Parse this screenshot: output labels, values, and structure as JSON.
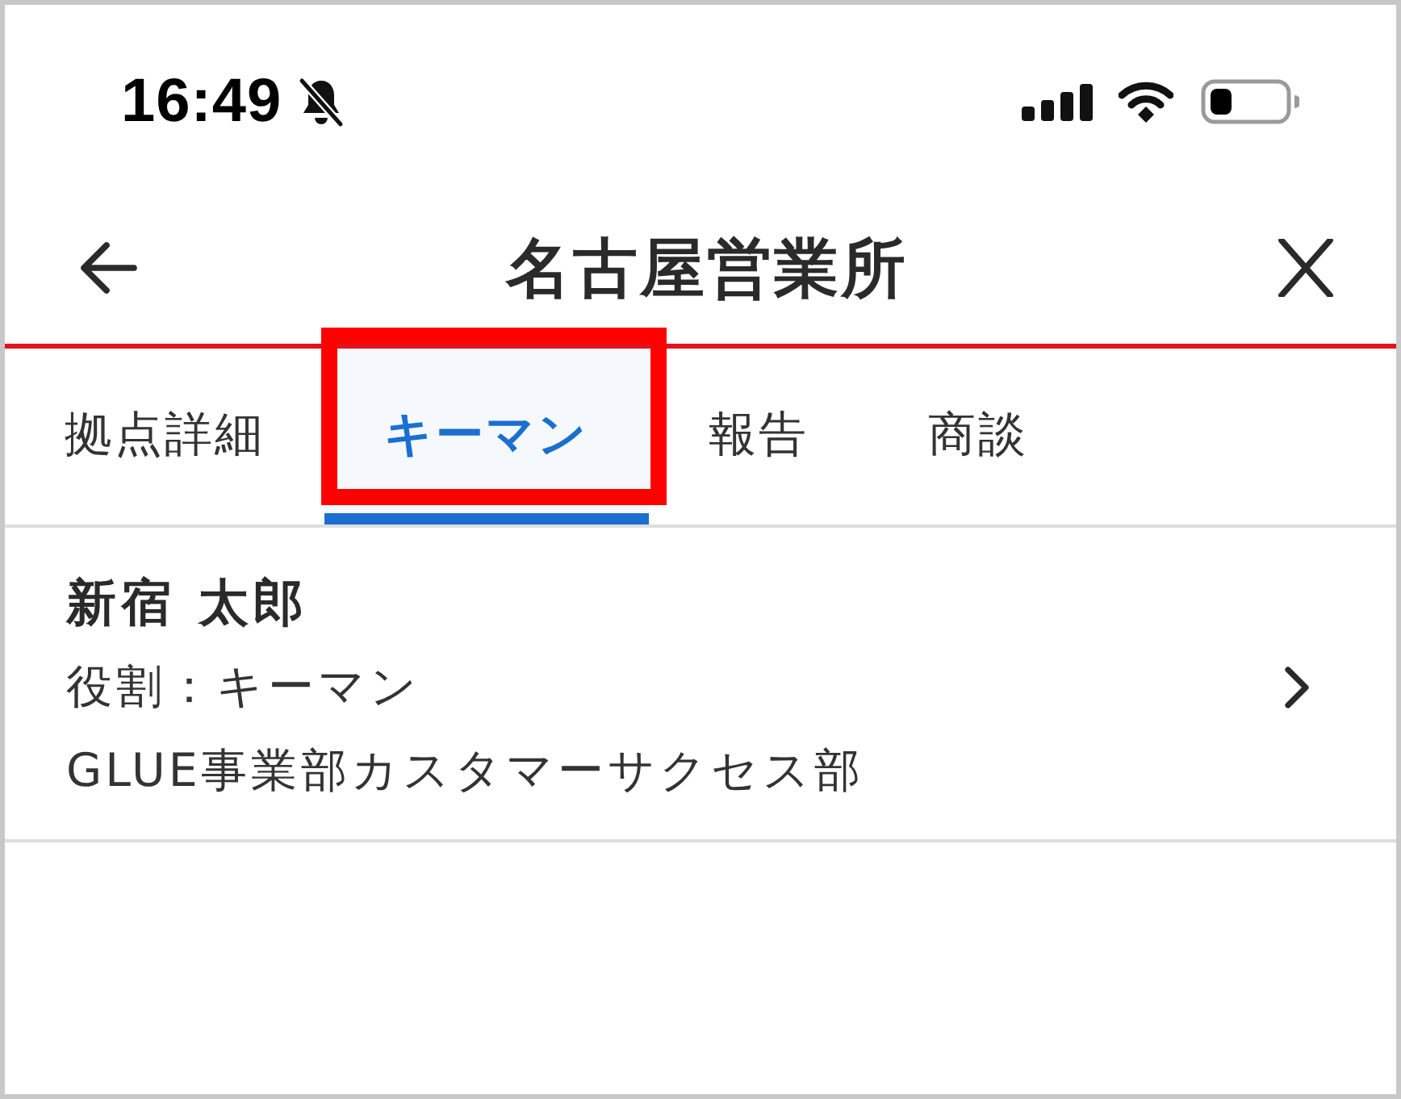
{
  "status_bar": {
    "time": "16:49"
  },
  "header": {
    "title": "名古屋営業所"
  },
  "tabs": [
    {
      "label": "拠点詳細",
      "selected": false,
      "highlighted": false
    },
    {
      "label": "キーマン",
      "selected": true,
      "highlighted": true
    },
    {
      "label": "報告",
      "selected": false,
      "highlighted": false
    },
    {
      "label": "商談",
      "selected": false,
      "highlighted": false
    }
  ],
  "contacts": [
    {
      "name": "新宿 太郎",
      "role": "役割：キーマン",
      "department": "GLUE事業部カスタマーサクセス部"
    }
  ]
}
